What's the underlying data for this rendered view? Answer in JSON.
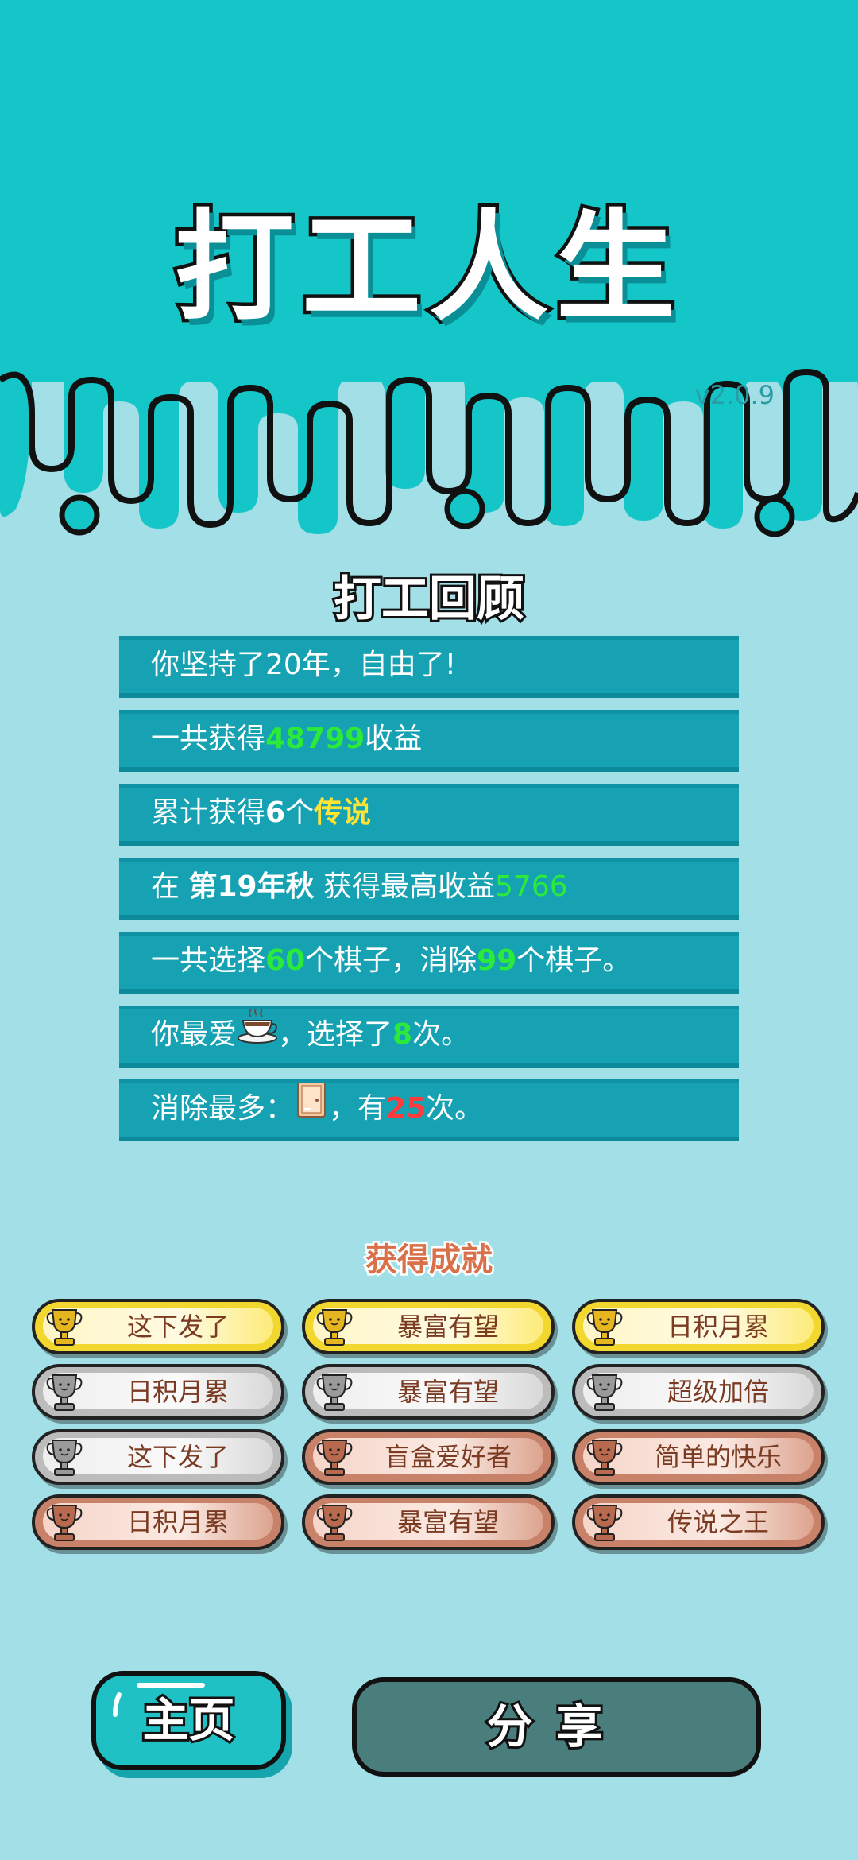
{
  "app": {
    "title": "打工人生",
    "version": "v2.0.9"
  },
  "colors": {
    "header_bg": "#15c6c8",
    "page_bg": "#a2dfe6",
    "row_bg": "#16a2b3",
    "highlight_green": "#2bea3a",
    "highlight_yellow": "#ffe433",
    "highlight_red": "#ff3b3b"
  },
  "review": {
    "title": "打工回顾",
    "row1": "你坚持了20年，自由了!",
    "row2": {
      "a": "一共获得",
      "v": "48799",
      "b": "收益"
    },
    "row3": {
      "a": "累计获得",
      "n": "6",
      "m": "个",
      "y": "传说"
    },
    "row4": {
      "a": "在 ",
      "season": "第19年秋",
      "b": " 获得最高收益",
      "v": "5766"
    },
    "row5": {
      "a": "一共选择",
      "v1": "60",
      "b": "个棋子，消除",
      "v2": "99",
      "c": "个棋子。"
    },
    "row6": {
      "a": "你最爱",
      "icon": "coffee-cup-icon",
      "b": "，选择了",
      "v": "8",
      "c": "次。"
    },
    "row7": {
      "a": "消除最多：",
      "icon": "door-icon",
      "b": "，有",
      "v": "25",
      "c": "次。"
    }
  },
  "achievements": {
    "title": "获得成就",
    "items": [
      {
        "label": "这下发了",
        "tier": "gold"
      },
      {
        "label": "暴富有望",
        "tier": "gold"
      },
      {
        "label": "日积月累",
        "tier": "gold"
      },
      {
        "label": "日积月累",
        "tier": "silver"
      },
      {
        "label": "暴富有望",
        "tier": "silver"
      },
      {
        "label": "超级加倍",
        "tier": "silver"
      },
      {
        "label": "这下发了",
        "tier": "silver"
      },
      {
        "label": "盲盒爱好者",
        "tier": "bronze"
      },
      {
        "label": "简单的快乐",
        "tier": "bronze"
      },
      {
        "label": "日积月累",
        "tier": "bronze"
      },
      {
        "label": "暴富有望",
        "tier": "bronze"
      },
      {
        "label": "传说之王",
        "tier": "bronze"
      }
    ]
  },
  "buttons": {
    "home": "主页",
    "share": "分享"
  }
}
